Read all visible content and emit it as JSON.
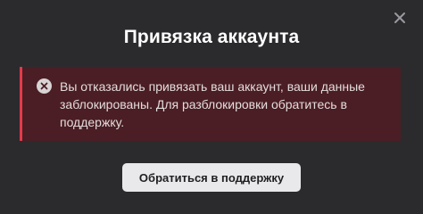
{
  "dialog": {
    "title": "Привязка аккаунта",
    "close_icon": "close-icon"
  },
  "alert": {
    "icon": "error-circle-x-icon",
    "message": "Вы отказались привязать ваш аккаунт, ваши данные заблокированы. Для разблокировки обратитесь в поддержку.",
    "colors": {
      "background": "#4a1e24",
      "accent": "#e23b4b"
    }
  },
  "actions": {
    "support_label": "Обратиться в поддержку"
  }
}
